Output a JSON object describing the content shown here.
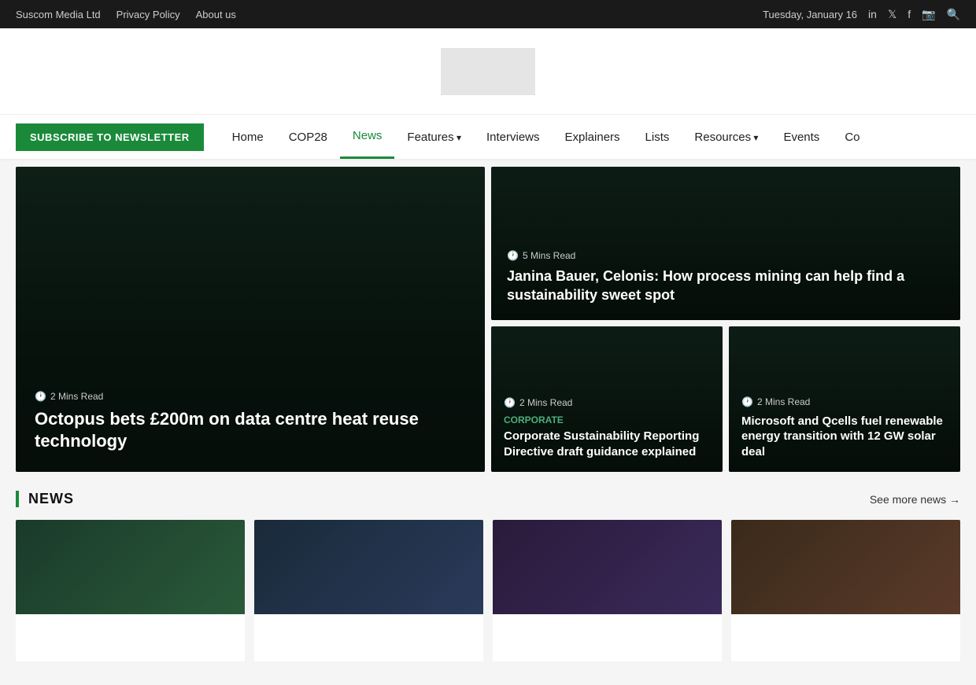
{
  "topbar": {
    "links": [
      {
        "label": "Suscom Media Ltd"
      },
      {
        "label": "Privacy Policy"
      },
      {
        "label": "About us"
      }
    ],
    "date": "Tuesday, January 16",
    "social_icons": [
      "linkedin",
      "twitter",
      "facebook",
      "instagram",
      "search"
    ]
  },
  "navbar": {
    "subscribe_label": "SUBSCRIBE TO NEWSLETTER",
    "items": [
      {
        "label": "Home",
        "active": false,
        "arrow": false
      },
      {
        "label": "COP28",
        "active": false,
        "arrow": false
      },
      {
        "label": "News",
        "active": true,
        "arrow": false
      },
      {
        "label": "Features",
        "active": false,
        "arrow": true
      },
      {
        "label": "Interviews",
        "active": false,
        "arrow": false
      },
      {
        "label": "Explainers",
        "active": false,
        "arrow": false
      },
      {
        "label": "Lists",
        "active": false,
        "arrow": false
      },
      {
        "label": "Resources",
        "active": false,
        "arrow": true
      },
      {
        "label": "Events",
        "active": false,
        "arrow": false
      },
      {
        "label": "Co",
        "active": false,
        "arrow": false
      }
    ]
  },
  "hero": {
    "left": {
      "mins": "2",
      "mins_label": "Mins Read",
      "title": "Octopus bets £200m on data centre heat reuse technology"
    },
    "top_right": {
      "mins": "5",
      "mins_label": "Mins Read",
      "title": "Janina Bauer, Celonis: How process mining can help find a sustainability sweet spot"
    },
    "bottom_left": {
      "mins": "2",
      "mins_label": "Mins Read",
      "tag": "Corporate",
      "title": "Corporate Sustainability Reporting Directive draft guidance explained"
    },
    "bottom_right": {
      "mins": "2",
      "mins_label": "Mins Read",
      "title": "Microsoft and Qcells fuel renewable energy transition with 12 GW solar deal"
    }
  },
  "news_section": {
    "title": "NEWS",
    "see_more_label": "See more news →"
  }
}
